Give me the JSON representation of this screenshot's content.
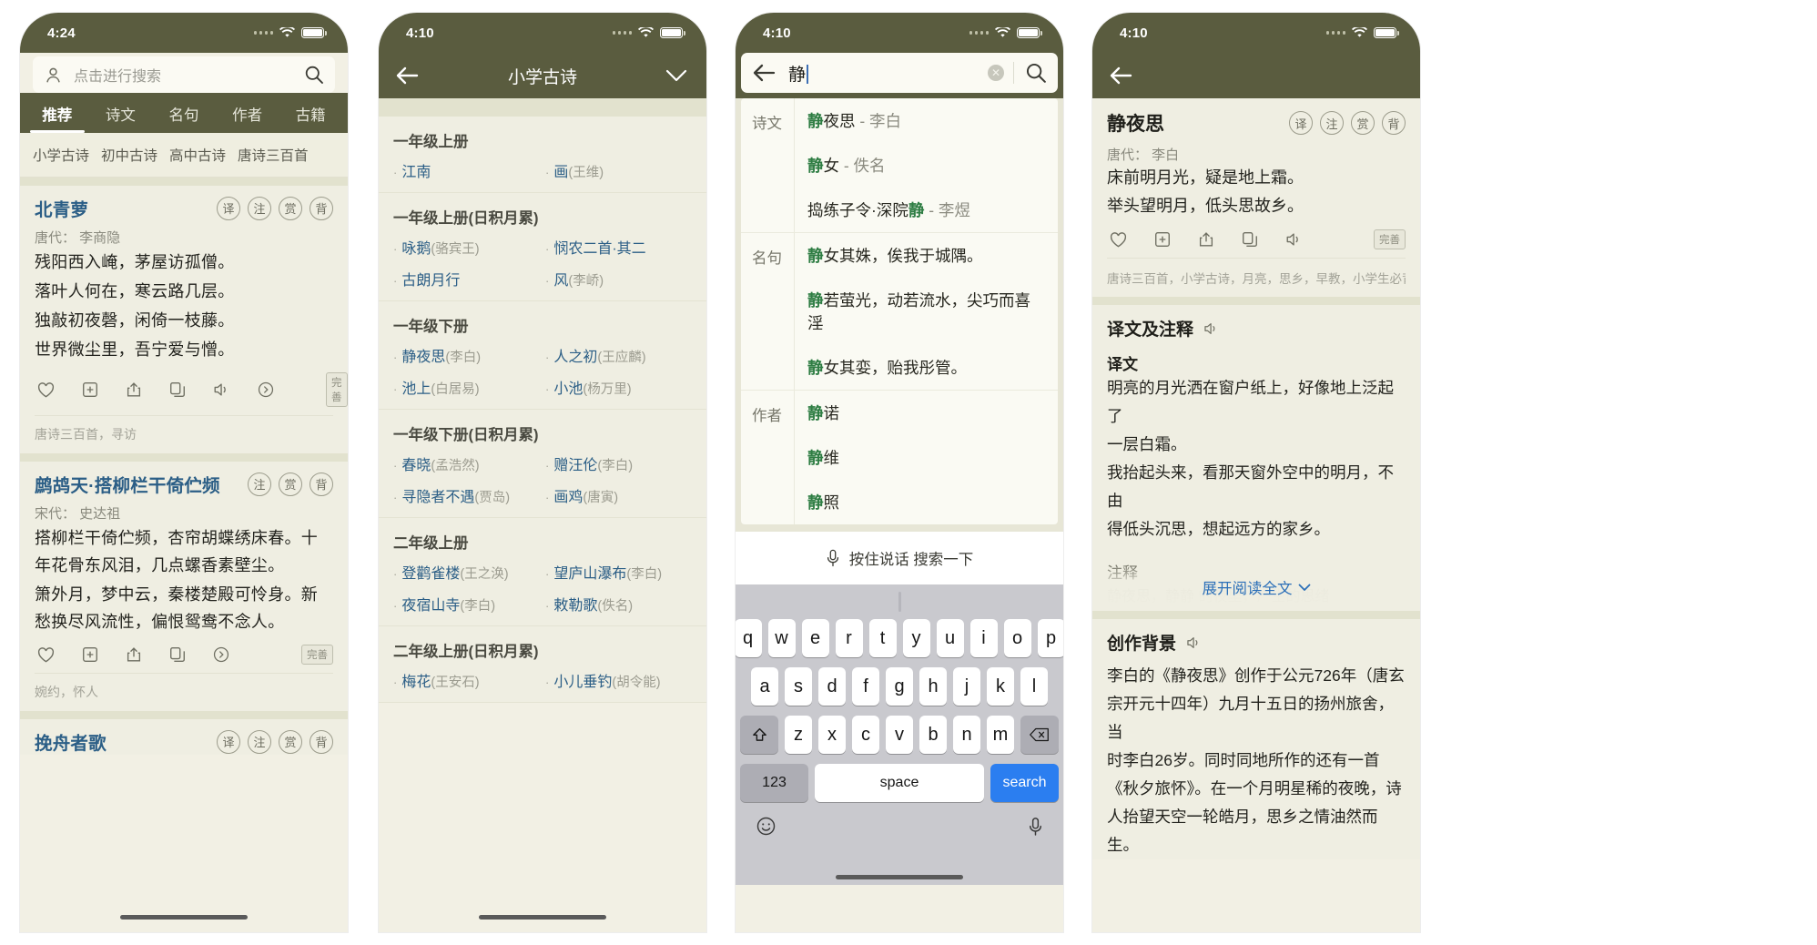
{
  "app": {
    "accent_blue": "#2B5E86",
    "brand_olive": "#5A5C3F",
    "bg_cream": "#EFEEE2",
    "highlight_green": "#2E7D43"
  },
  "panel1": {
    "status": {
      "time": "4:24"
    },
    "search": {
      "placeholder": "点击进行搜索",
      "avatar_icon": "person-icon",
      "search_icon": "search-icon"
    },
    "tabs": [
      {
        "label": "推荐",
        "active": true
      },
      {
        "label": "诗文",
        "active": false
      },
      {
        "label": "名句",
        "active": false
      },
      {
        "label": "作者",
        "active": false
      },
      {
        "label": "古籍",
        "active": false
      }
    ],
    "categories": [
      "小学古诗",
      "初中古诗",
      "高中古诗",
      "唐诗三百首"
    ],
    "cards": [
      {
        "title": "北青萝",
        "badges": [
          "译",
          "注",
          "赏",
          "背"
        ],
        "author": "唐代： 李商隐",
        "lines": [
          "残阳西入崦，茅屋访孤僧。",
          "落叶人何在，寒云路几层。",
          "独敲初夜磬，闲倚一枝藤。",
          "世界微尘里，吾宁爱与憎。"
        ],
        "actions": [
          "heart-icon",
          "plus-box-icon",
          "share-icon",
          "copy-icon",
          "speaker-icon",
          "arrow-right-circle-icon"
        ],
        "status_badge": "完善",
        "tags": "唐诗三百首，寻访"
      },
      {
        "title": "鹧鸪天·搭柳栏干倚伫频",
        "badges": [
          "注",
          "赏",
          "背"
        ],
        "author": "宋代： 史达祖",
        "lines": [
          "搭柳栏干倚伫频，杏帘胡蝶绣床春。十年花骨东风泪，几点螺香素壁尘。",
          "箫外月，梦中云，秦楼楚殿可怜身。新愁换尽风流性，偏恨鸳鸯不念人。"
        ],
        "actions": [
          "heart-icon",
          "plus-box-icon",
          "share-icon",
          "copy-icon",
          "arrow-right-circle-icon"
        ],
        "status_badge": "完善",
        "tags": "婉约，怀人"
      },
      {
        "title": "挽舟者歌",
        "badges": [
          "译",
          "注",
          "赏",
          "背"
        ]
      }
    ]
  },
  "panel2": {
    "status": {
      "time": "4:10"
    },
    "nav": {
      "title": "小学古诗",
      "back_icon": "back-arrow-icon",
      "chevron_icon": "chevron-down-icon"
    },
    "groups": [
      {
        "title": "一年级上册",
        "items": [
          {
            "name": "江南",
            "author": ""
          },
          {
            "name": "画",
            "author": "(王维)"
          }
        ]
      },
      {
        "title": "一年级上册(日积月累)",
        "items": [
          {
            "name": "咏鹅",
            "author": "(骆宾王)"
          },
          {
            "name": "悯农二首·其二",
            "author": ""
          },
          {
            "name": "古朗月行",
            "author": ""
          },
          {
            "name": "风",
            "author": "(李峤)"
          }
        ]
      },
      {
        "title": "一年级下册",
        "items": [
          {
            "name": "静夜思",
            "author": "(李白)"
          },
          {
            "name": "人之初",
            "author": "(王应麟)"
          },
          {
            "name": "池上",
            "author": "(白居易)"
          },
          {
            "name": "小池",
            "author": "(杨万里)"
          }
        ]
      },
      {
        "title": "一年级下册(日积月累)",
        "items": [
          {
            "name": "春晓",
            "author": "(孟浩然)"
          },
          {
            "name": "赠汪伦",
            "author": "(李白)"
          },
          {
            "name": "寻隐者不遇",
            "author": "(贾岛)"
          },
          {
            "name": "画鸡",
            "author": "(唐寅)"
          }
        ]
      },
      {
        "title": "二年级上册",
        "items": [
          {
            "name": "登鹳雀楼",
            "author": "(王之涣)"
          },
          {
            "name": "望庐山瀑布",
            "author": "(李白)"
          },
          {
            "name": "夜宿山寺",
            "author": "(李白)"
          },
          {
            "name": "敕勒歌",
            "author": "(佚名)"
          }
        ]
      },
      {
        "title": "二年级上册(日积月累)",
        "items": [
          {
            "name": "梅花",
            "author": "(王安石)"
          },
          {
            "name": "小儿垂钓",
            "author": "(胡令能)"
          }
        ]
      }
    ]
  },
  "panel3": {
    "status": {
      "time": "4:10"
    },
    "search": {
      "value": "静",
      "back_icon": "back-arrow-icon",
      "clear_icon": "clear-circle-icon",
      "search_icon": "search-icon"
    },
    "suggestion_groups": [
      {
        "label": "诗文",
        "items": [
          {
            "hl": "静",
            "rest": "夜思",
            "tail": " - 李白"
          },
          {
            "hl": "静",
            "rest": "女",
            "tail": " - 佚名"
          },
          {
            "pre": "捣练子令·深院",
            "hl": "静",
            "rest": "",
            "tail": " - 李煜"
          }
        ]
      },
      {
        "label": "名句",
        "items": [
          {
            "hl": "静",
            "rest": "女其姝，俟我于城隅。",
            "tail": ""
          },
          {
            "hl": "静",
            "rest": "若萤光，动若流水，尖巧而喜淫",
            "tail": ""
          },
          {
            "hl": "静",
            "rest": "女其娈，贻我彤管。",
            "tail": ""
          }
        ]
      },
      {
        "label": "作者",
        "items": [
          {
            "hl": "静",
            "rest": "诺",
            "tail": ""
          },
          {
            "hl": "静",
            "rest": "维",
            "tail": ""
          },
          {
            "hl": "静",
            "rest": "照",
            "tail": ""
          }
        ]
      }
    ],
    "voicebar": {
      "label": "按住说话 搜索一下",
      "mic_icon": "microphone-icon"
    },
    "keyboard": {
      "row1": [
        "q",
        "w",
        "e",
        "r",
        "t",
        "y",
        "u",
        "i",
        "o",
        "p"
      ],
      "row2": [
        "a",
        "s",
        "d",
        "f",
        "g",
        "h",
        "j",
        "k",
        "l"
      ],
      "row3": [
        "z",
        "x",
        "c",
        "v",
        "b",
        "n",
        "m"
      ],
      "shift_icon": "shift-icon",
      "backspace_icon": "backspace-icon",
      "num_key": "123",
      "space_key": "space",
      "search_key": "search",
      "emoji_icon": "emoji-icon",
      "dictate_icon": "microphone-icon"
    }
  },
  "panel4": {
    "status": {
      "time": "4:10"
    },
    "nav": {
      "back_icon": "back-arrow-icon"
    },
    "poem": {
      "title": "静夜思",
      "badges": [
        "译",
        "注",
        "赏",
        "背"
      ],
      "author": "唐代： 李白",
      "lines": [
        "床前明月光，疑是地上霜。",
        "举头望明月，低头思故乡。"
      ],
      "actions": [
        "heart-icon",
        "plus-box-icon",
        "share-icon",
        "copy-icon",
        "speaker-icon"
      ],
      "status_badge": "完善",
      "tags": "唐诗三百首，小学古诗，月亮，思乡，早教，小学生必背"
    },
    "translation": {
      "heading": "译文及注释",
      "speaker_icon": "speaker-icon",
      "sub_heading": "译文",
      "body": [
        "明亮的月光洒在窗户纸上，好像地上泛起了",
        "一层白霜。",
        "我抬起头来，看那天窗外空中的明月，不由",
        "得低头沉思，想起远方的家乡。"
      ],
      "notes_heading": "注释",
      "notes_faded": "静夜思，静静 的夜里，产生的思绪",
      "expand_label": "展开阅读全文",
      "expand_icon": "chevron-down-icon"
    },
    "background": {
      "heading": "创作背景",
      "speaker_icon": "speaker-icon",
      "body": [
        "李白的《静夜思》创作于公元726年（唐玄",
        "宗开元十四年）九月十五日的扬州旅舍，当",
        "时李白26岁。同时同地所作的还有一首",
        "《秋夕旅怀》。在一个月明星稀的夜晚，诗",
        "人抬望天空一轮皓月，思乡之情油然而生。"
      ]
    }
  }
}
